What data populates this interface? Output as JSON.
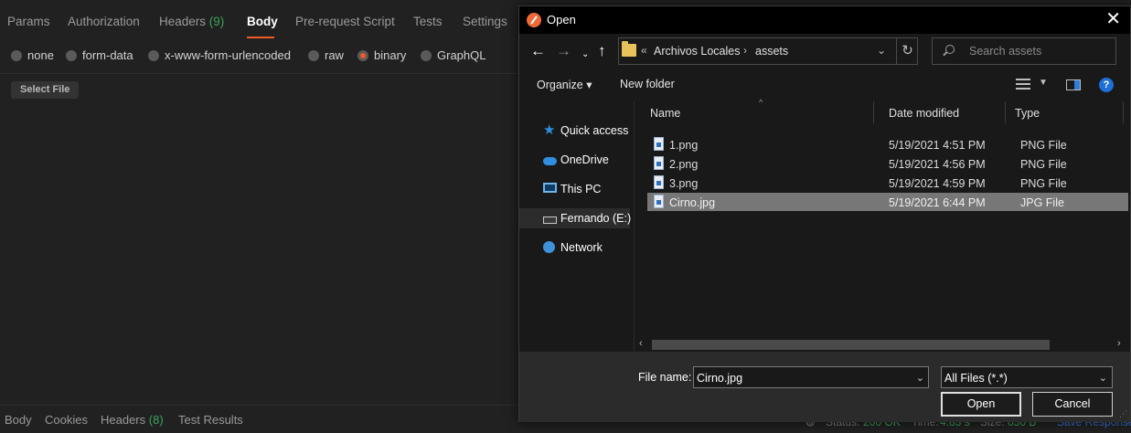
{
  "postman": {
    "tabs": [
      {
        "label": "Params"
      },
      {
        "label": "Authorization"
      },
      {
        "label": "Headers",
        "count": "(9)"
      },
      {
        "label": "Body"
      },
      {
        "label": "Pre-request Script"
      },
      {
        "label": "Tests"
      },
      {
        "label": "Settings"
      }
    ],
    "body_types": [
      "none",
      "form-data",
      "x-www-form-urlencoded",
      "raw",
      "binary",
      "GraphQL"
    ],
    "selected_body_type": "binary",
    "select_file_label": "Select File",
    "response_tabs": [
      {
        "label": "Body"
      },
      {
        "label": "Cookies"
      },
      {
        "label": "Headers",
        "count": "(8)"
      },
      {
        "label": "Test Results"
      }
    ],
    "status": {
      "status_label": "Status:",
      "status_value": "200 OK",
      "time_label": "Time:",
      "time_value": "4.83 s",
      "size_label": "Size:",
      "size_value": "630 B",
      "save_response": "Save Response"
    },
    "colors": {
      "accent": "#ef5b25",
      "count": "#3ca55c",
      "link": "#3d74d9"
    }
  },
  "dialog": {
    "title": "Open",
    "breadcrumb": {
      "overflow": "«",
      "items": [
        "Archivos Locales",
        "assets"
      ]
    },
    "search_placeholder": "Search assets",
    "organize_label": "Organize ▾",
    "new_folder_label": "New folder",
    "help_label": "?",
    "nav_items": [
      {
        "label": "Quick access",
        "icon": "star-icon"
      },
      {
        "label": "OneDrive",
        "icon": "cloud-icon"
      },
      {
        "label": "This PC",
        "icon": "computer-icon"
      },
      {
        "label": "Fernando (E:)",
        "icon": "drive-icon"
      },
      {
        "label": "Network",
        "icon": "network-icon"
      }
    ],
    "columns": [
      "Name",
      "Date modified",
      "Type"
    ],
    "files": [
      {
        "name": "1.png",
        "date": "5/19/2021 4:51 PM",
        "type": "PNG File"
      },
      {
        "name": "2.png",
        "date": "5/19/2021 4:56 PM",
        "type": "PNG File"
      },
      {
        "name": "3.png",
        "date": "5/19/2021 4:59 PM",
        "type": "PNG File"
      },
      {
        "name": "Cirno.jpg",
        "date": "5/19/2021 6:44 PM",
        "type": "JPG File"
      }
    ],
    "selected_file": "Cirno.jpg",
    "file_name_label": "File name:",
    "file_name_value": "Cirno.jpg",
    "file_type_value": "All Files (*.*)",
    "open_label": "Open",
    "cancel_label": "Cancel"
  }
}
